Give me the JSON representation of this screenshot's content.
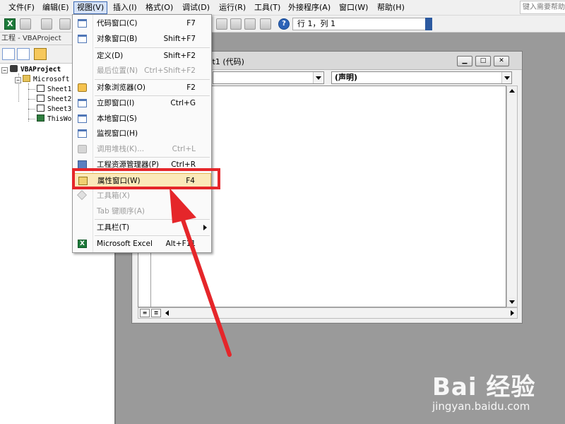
{
  "menubar": {
    "items": [
      "文件(F)",
      "编辑(E)",
      "视图(V)",
      "插入(I)",
      "格式(O)",
      "调试(D)",
      "运行(R)",
      "工具(T)",
      "外接程序(A)",
      "窗口(W)",
      "帮助(H)"
    ],
    "help_placeholder": "键入需要帮助"
  },
  "toolbar": {
    "position_text": "行 1，列 1"
  },
  "project": {
    "title": "工程 - VBAProject",
    "nodes": [
      "VBAProject",
      "Microsoft",
      "Sheet1",
      "Sheet2",
      "Sheet3",
      "ThisWor"
    ]
  },
  "code_window": {
    "title": "eet1 (代码)",
    "procedure_combo": "(声明)",
    "object_combo": ""
  },
  "view_menu": {
    "items": [
      {
        "label": "代码窗口(C)",
        "shortcut": "F7",
        "disabled": false
      },
      {
        "label": "对象窗口(B)",
        "shortcut": "Shift+F7",
        "disabled": false
      },
      {
        "label": "定义(D)",
        "shortcut": "Shift+F2",
        "disabled": false
      },
      {
        "label": "最后位置(N)",
        "shortcut": "Ctrl+Shift+F2",
        "disabled": true
      },
      {
        "label": "对象浏览器(O)",
        "shortcut": "F2",
        "disabled": false
      },
      {
        "label": "立即窗口(I)",
        "shortcut": "Ctrl+G",
        "disabled": false
      },
      {
        "label": "本地窗口(S)",
        "shortcut": "",
        "disabled": false
      },
      {
        "label": "监视窗口(H)",
        "shortcut": "",
        "disabled": false
      },
      {
        "label": "调用堆栈(K)...",
        "shortcut": "Ctrl+L",
        "disabled": true
      },
      {
        "label": "工程资源管理器(P)",
        "shortcut": "Ctrl+R",
        "disabled": false
      },
      {
        "label": "属性窗口(W)",
        "shortcut": "F4",
        "disabled": false,
        "highlighted": true
      },
      {
        "label": "工具箱(X)",
        "shortcut": "",
        "disabled": true
      },
      {
        "label": "Tab 键顺序(A)",
        "shortcut": "",
        "disabled": true
      },
      {
        "label": "工具栏(T)",
        "shortcut": "",
        "disabled": false,
        "submenu": true
      },
      {
        "label": "Microsoft Excel",
        "shortcut": "Alt+F11",
        "disabled": false
      }
    ]
  },
  "watermark": {
    "brand": "Bai 经验",
    "url": "jingyan.baidu.com"
  },
  "colors": {
    "highlight": "#e5262a",
    "menu_hover": "#fbe9b9",
    "background": "#9a9a9a"
  }
}
